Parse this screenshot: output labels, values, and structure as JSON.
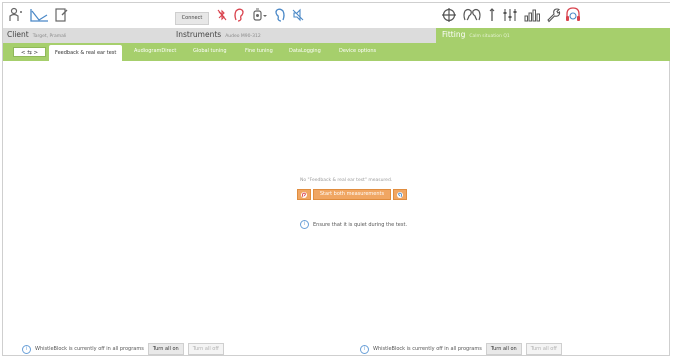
{
  "toolbar": {
    "connect_label": "Connect",
    "icons": [
      "person-icon",
      "graph-icon",
      "document-icon",
      "no-bluetooth-icon",
      "ear-red-icon",
      "device-icon",
      "ear-blue-icon",
      "mute-icon",
      "target-icon",
      "ears-icon",
      "pin-icon",
      "sliders-icon",
      "levels-icon",
      "wrench-icon",
      "headset-icon"
    ]
  },
  "infobar": {
    "client_label": "Client",
    "client_value": "Target, Pramali",
    "instruments_label": "Instruments",
    "instruments_value": "Audeo M90-312",
    "fitting_label": "Fitting",
    "fitting_value": "Calm situation Q1"
  },
  "nav": {
    "label": "< ⇆ >"
  },
  "tabs": [
    {
      "label": "Feedback & real ear test",
      "active": true
    },
    {
      "label": "AudiogramDirect",
      "active": false
    },
    {
      "label": "Global tuning",
      "active": false
    },
    {
      "label": "Fine tuning",
      "active": false
    },
    {
      "label": "DataLogging",
      "active": false
    },
    {
      "label": "Device options",
      "active": false
    }
  ],
  "main": {
    "status_message": "No \"Feedback & real ear test\" measured.",
    "start_left_icon": "ear-red-icon",
    "start_button_label": "Start both measurements",
    "start_right_icon": "ear-blue-icon",
    "quiet_info": "Ensure that it is quiet during the test."
  },
  "whistleblock": {
    "left": {
      "text": "WhistleBlock is currently off in all programs",
      "on_label": "Turn all on",
      "off_label": "Turn all off"
    },
    "right": {
      "text": "WhistleBlock is currently off in all programs",
      "on_label": "Turn all on",
      "off_label": "Turn all off"
    }
  },
  "colors": {
    "accent_green": "#a6cf6c",
    "orange": "#f0a663",
    "red": "#d9434e",
    "blue": "#4a88c7"
  }
}
